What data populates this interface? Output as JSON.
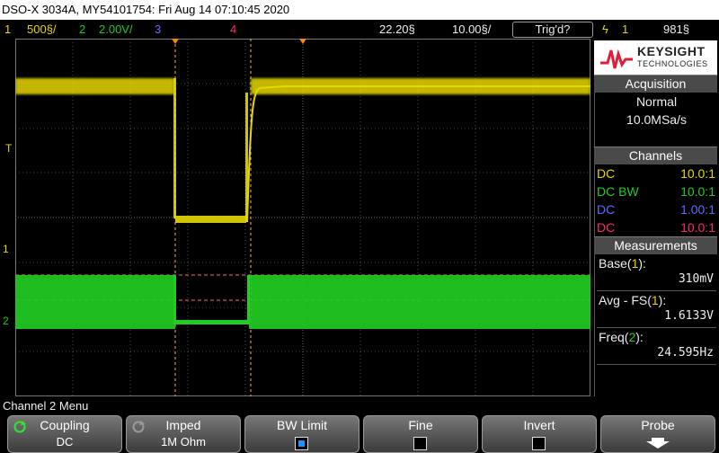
{
  "title": "DSO-X 3034A, MY54101754: Fri Aug 14 07:10:45 2020",
  "status": {
    "ch1_num": "1",
    "ch1_scale": "500§/",
    "ch2_num": "2",
    "ch2_scale": "2.00V/",
    "ch3_num": "3",
    "ch4_num": "4",
    "time_ref": "22.20§",
    "time_scale": "10.00§/",
    "trig_status": "Trig'd?",
    "trig_icon": "ϟ",
    "trig_src": "1",
    "trig_level": "981§"
  },
  "logo": {
    "brand": "KEYSIGHT",
    "sub": "TECHNOLOGIES"
  },
  "acquisition": {
    "title": "Acquisition",
    "mode": "Normal",
    "rate": "10.0MSa/s"
  },
  "channels": {
    "title": "Channels",
    "rows": [
      {
        "coupling": "DC",
        "ratio": "10.0:1",
        "color": "#e6d800"
      },
      {
        "coupling": "DC BW",
        "ratio": "10.0:1",
        "color": "#22cc22"
      },
      {
        "coupling": "DC",
        "ratio": "1.00:1",
        "color": "#5a6cff"
      },
      {
        "coupling": "DC",
        "ratio": "10.0:1",
        "color": "#ff2a6a"
      }
    ]
  },
  "measurements": {
    "title": "Measurements",
    "items": [
      {
        "label": "Base(",
        "src": "1",
        "close": "):",
        "value": "310mV"
      },
      {
        "label": "Avg - FS(",
        "src": "1",
        "close": "):",
        "value": "1.6133V"
      },
      {
        "label": "Freq(",
        "src": "2",
        "close": "):",
        "value": "24.595Hz"
      }
    ]
  },
  "markers": {
    "trigger": "T",
    "ch1": "1",
    "ch2": "2"
  },
  "menu": {
    "title": "Channel 2 Menu",
    "softkeys": [
      {
        "label": "Coupling",
        "value": "DC"
      },
      {
        "label": "Imped",
        "value": "1M Ohm"
      },
      {
        "label": "BW Limit",
        "checked": true
      },
      {
        "label": "Fine",
        "checked": false
      },
      {
        "label": "Invert",
        "checked": false
      },
      {
        "label": "Probe"
      }
    ]
  },
  "colors": {
    "ch1": "#e6d800",
    "ch2": "#22cc22",
    "ch3": "#5a6cff",
    "ch4": "#ff2a6a",
    "trigger": "#ff8800"
  }
}
